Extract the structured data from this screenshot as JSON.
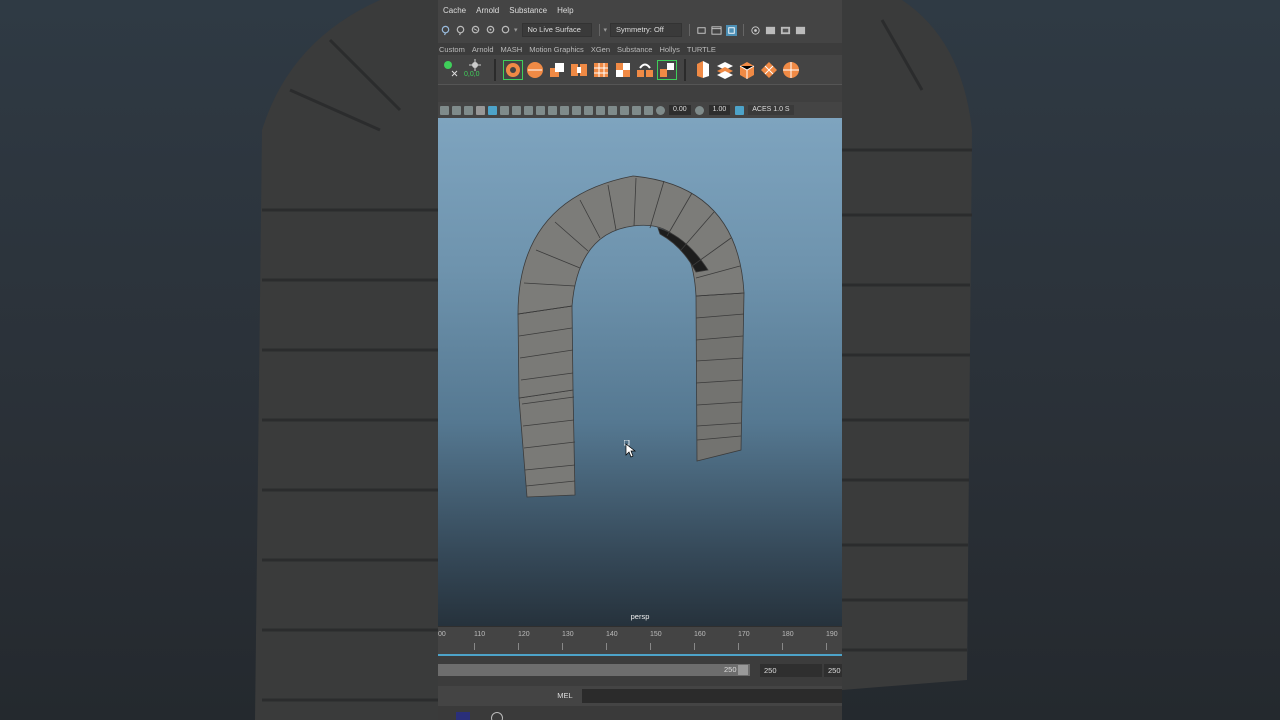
{
  "menu": [
    "Cache",
    "Arnold",
    "Substance",
    "Help"
  ],
  "status_line": {
    "live_surface": "No Live Surface",
    "symmetry": "Symmetry: Off"
  },
  "shelf_tabs": [
    "Custom",
    "Arnold",
    "MASH",
    "Motion Graphics",
    "XGen",
    "Substance",
    "Hollys",
    "TURTLE"
  ],
  "shelf_readout": "0,0,0",
  "view_toolbar": {
    "exposure": "0.00",
    "gamma": "1.00",
    "color_space": "ACES 1.0 S"
  },
  "viewport": {
    "camera_label": "persp"
  },
  "timeline": {
    "start_label": "00",
    "ticks": [
      "110",
      "120",
      "130",
      "140",
      "150",
      "160",
      "170",
      "180",
      "190"
    ]
  },
  "range": {
    "end_value": "250",
    "anim_end": "250",
    "playback_end": "250"
  },
  "command_line": {
    "language": "MEL"
  },
  "colors": {
    "shelf_accent": "#f08a45",
    "selected_green": "#3fcf5a",
    "timeline_line": "#4da3c9",
    "ui_bg": "#444444"
  },
  "icons": [
    "lasso-icon",
    "snap-grid-icon",
    "snap-curve-icon",
    "snap-point-icon",
    "snap-plane-icon",
    "render-icon",
    "cube-icon",
    "torus-icon",
    "cursor-icon"
  ]
}
